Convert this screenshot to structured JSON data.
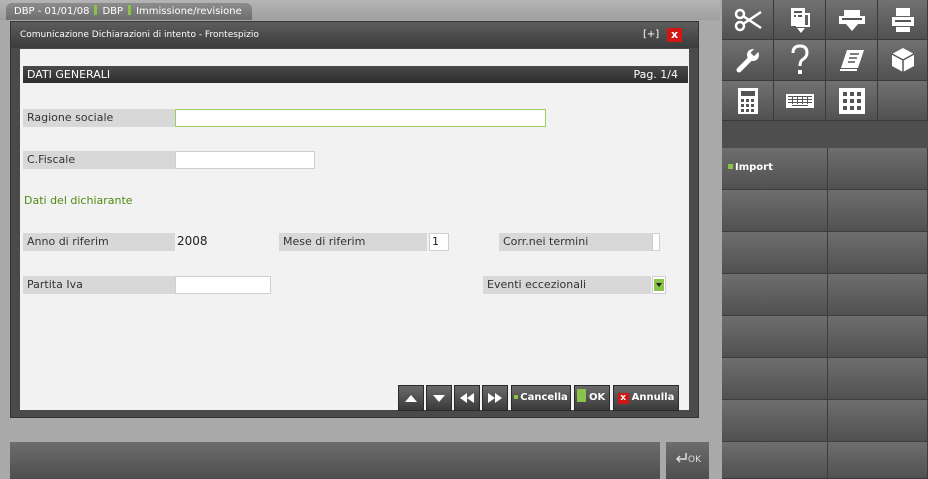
{
  "tabbar": {
    "part1": "DBP - 01/01/08",
    "part2": "DBP",
    "part3": "Immissione/revisione"
  },
  "dialog": {
    "title": "Comunicazione Dichiarazioni di intento - Frontespizio",
    "move_glyph": "[+]",
    "close_glyph": "x",
    "section_title": "DATI GENERALI",
    "page": "Pag. 1/4",
    "fields": {
      "ragione_sociale": {
        "label": "Ragione sociale",
        "value": ""
      },
      "cfiscale": {
        "label": "C.Fiscale",
        "value": ""
      },
      "dati_dichiarante": "Dati del dichiarante",
      "anno": {
        "label": "Anno di riferim",
        "value": "2008"
      },
      "mese": {
        "label": "Mese di riferim",
        "value": "1"
      },
      "corr": {
        "label": "Corr.nei termini",
        "value": ""
      },
      "partita_iva": {
        "label": "Partita Iva",
        "value": ""
      },
      "eventi": {
        "label": "Eventi eccezionali",
        "value": ""
      }
    },
    "buttons": {
      "cancella": "Cancella",
      "ok": "OK",
      "annulla": "Annulla",
      "annulla_glyph": "x"
    }
  },
  "bottom": {
    "ok_label": "OK"
  },
  "toolbar": {
    "icons": [
      "scissors-icon",
      "copy-icon",
      "print-preview-icon",
      "printer-icon",
      "wrench-icon",
      "help-icon",
      "notepad-icon",
      "cube-icon",
      "calculator-icon",
      "keyboard-icon",
      "keypad-icon",
      ""
    ],
    "import_label": "Import"
  },
  "colors": {
    "accent_green": "#8bc34a",
    "close_red": "#d21515"
  }
}
